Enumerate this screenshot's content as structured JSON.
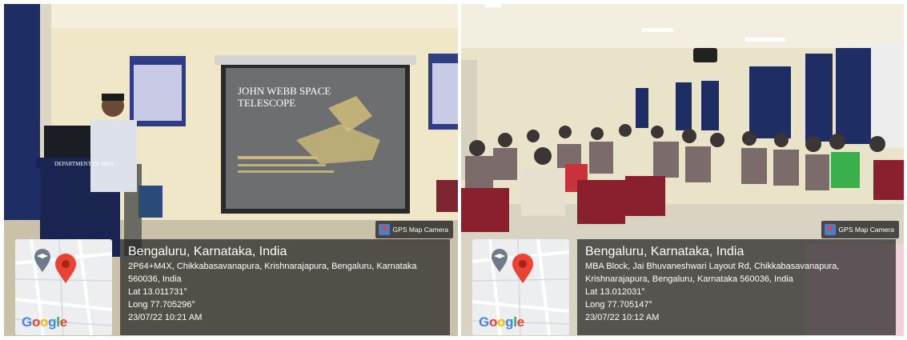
{
  "photos": [
    {
      "badge": "GPS Map Camera",
      "slide": {
        "title_line1": "JOHN WEBB SPACE",
        "title_line2": "TELESCOPE"
      },
      "podium_label": "DEPARTMENT OF MBA",
      "location_title": "Bengaluru, Karnataka, India",
      "address_line1": "2P64+M4X, Chikkabasavanapura, Krishnarajapura, Bengaluru, Karnataka",
      "address_line2": "560036, India",
      "lat": "Lat 13.011731°",
      "long": "Long 77.705296°",
      "datetime": "23/07/22 10:21 AM",
      "map_logo": "Google"
    },
    {
      "badge": "GPS Map Camera",
      "location_title": "Bengaluru, Karnataka, India",
      "address_line1": "MBA Block, Jai Bhuvaneshwari Layout Rd, Chikkabasavanapura,",
      "address_line2": "Krishnarajapura, Bengaluru, Karnataka 560036, India",
      "lat": "Lat 13.012031°",
      "long": "Long 77.705147°",
      "datetime": "23/07/22 10:12 AM",
      "map_logo": "Google"
    }
  ],
  "colors": {
    "wall": "#efe7c8",
    "curtain": "#1e2d63",
    "chair": "#8a1f2e",
    "overlay": "#232323",
    "google_blue": "#4285f4",
    "google_red": "#ea4335",
    "google_yellow": "#fbbc05",
    "google_green": "#34a853"
  },
  "icons": [
    "map-pin-icon",
    "graduation-cap-icon",
    "gps-camera-icon"
  ]
}
